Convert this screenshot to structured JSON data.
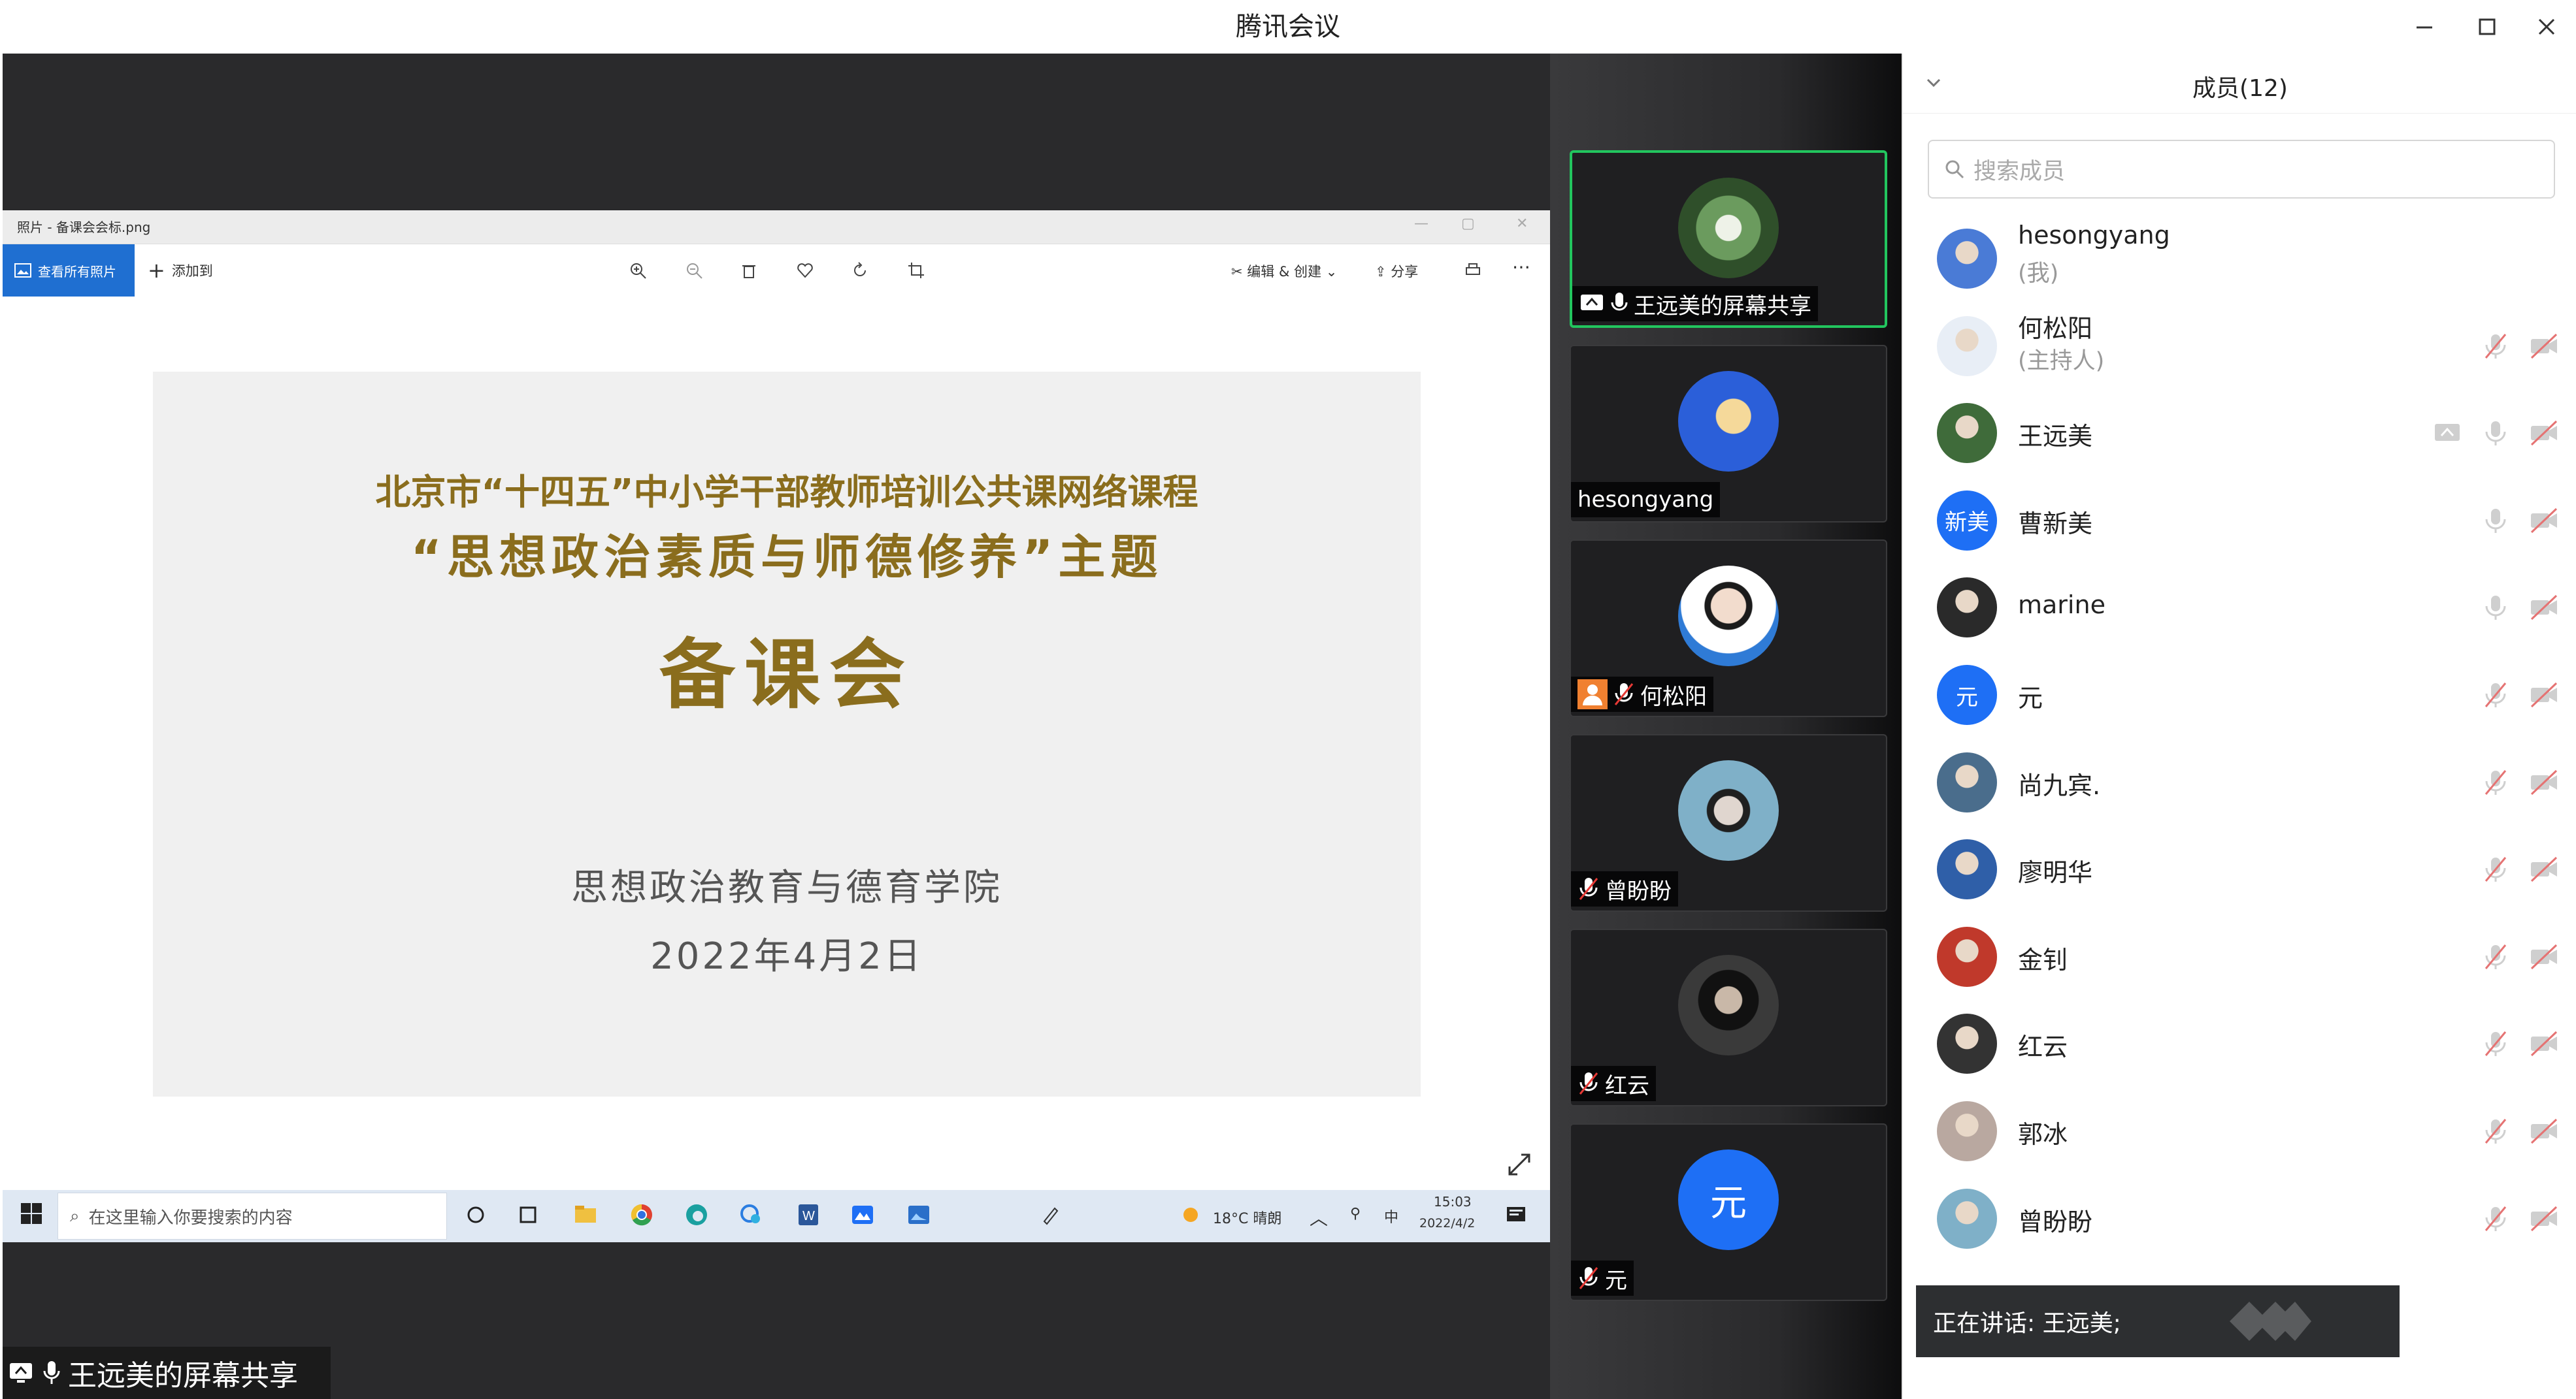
{
  "window": {
    "title": "腾讯会议"
  },
  "photo_app": {
    "title": "照片 - 备课会会标.png",
    "view_all_label": "查看所有照片",
    "add_label": "添加到",
    "edit_label": "编辑 & 创建",
    "share_label": "分享"
  },
  "slide": {
    "line1": "北京市“十四五”中小学干部教师培训公共课网络课程",
    "line2": "“思想政治素质与师德修养”主题",
    "line3": "备课会",
    "line4": "思想政治教育与德育学院",
    "line5": "2022年4月2日"
  },
  "taskbar": {
    "search_placeholder": "在这里输入你要搜索的内容",
    "weather": "18°C 晴朗",
    "ime": "中",
    "time": "15:03",
    "date": "2022/4/2"
  },
  "share_label": "王远美的屏幕共享",
  "video_tiles": [
    {
      "name": "王远美的屏幕共享",
      "avatar_color": "#3f6b3a"
    },
    {
      "name": "hesongyang",
      "avatar_color": "#2b5fd9"
    },
    {
      "name": "何松阳",
      "avatar_color": "#ffffff"
    },
    {
      "name": "曾盼盼",
      "avatar_color": "#7fb0c8"
    },
    {
      "name": "红云",
      "avatar_color": "#3a3a3a"
    },
    {
      "name": "元",
      "avatar_text": "元",
      "avatar_color": "#1e6ff5"
    }
  ],
  "members": {
    "header": "成员(12)",
    "search_placeholder": "搜索成员",
    "list": [
      {
        "name": "hesongyang",
        "sub": "(我)",
        "avatar_color": "#4a7bd6"
      },
      {
        "name": "何松阳",
        "sub": "(主持人)",
        "avatar_color": "#e8eef6"
      },
      {
        "name": "王远美",
        "avatar_color": "#3f6b3a"
      },
      {
        "name": "曹新美",
        "avatar_text": "新美",
        "avatar_color": "#1e6ff5"
      },
      {
        "name": "marine",
        "avatar_color": "#2a2a2a"
      },
      {
        "name": "元",
        "avatar_text": "元",
        "avatar_color": "#1e6ff5"
      },
      {
        "name": "尚九宾.",
        "avatar_color": "#4a6d8c"
      },
      {
        "name": "廖明华",
        "avatar_color": "#2f5fa8"
      },
      {
        "name": "金钊",
        "avatar_color": "#c0392b"
      },
      {
        "name": "红云",
        "avatar_color": "#333333"
      },
      {
        "name": "郭冰",
        "avatar_color": "#b9a8a0"
      },
      {
        "name": "曾盼盼",
        "avatar_color": "#7fb0c8"
      }
    ]
  },
  "speaking": "正在讲话: 王远美;"
}
